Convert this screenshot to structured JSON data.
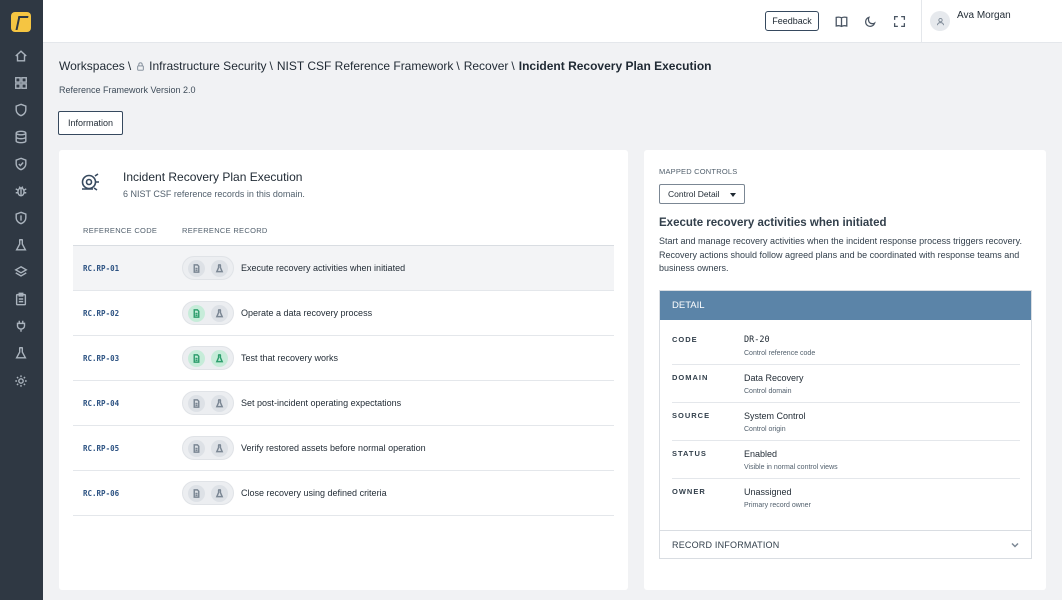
{
  "header": {
    "feedback_label": "Feedback",
    "user_name": "Ava Morgan"
  },
  "sidebar": {
    "items": [
      "home-icon",
      "grid-icon",
      "shield-icon",
      "database-icon",
      "shield-check-icon",
      "bug-icon",
      "shield-icon",
      "flask-icon",
      "layers-icon",
      "clipboard-icon",
      "plug-icon",
      "flask-icon",
      "gear-icon"
    ]
  },
  "breadcrumb": {
    "items": [
      "Workspaces",
      "Infrastructure Security",
      "NIST CSF Reference Framework",
      "Recover"
    ],
    "separator": "\\",
    "current": "Incident Recovery Plan Execution"
  },
  "page": {
    "subtitle": "Reference Framework Version 2.0",
    "info_button": "Information"
  },
  "left_panel": {
    "title": "Incident Recovery Plan Execution",
    "subtitle": "6 NIST CSF reference records in this domain.",
    "columns": [
      "REFERENCE CODE",
      "REFERENCE RECORD"
    ],
    "rows": [
      {
        "code": "RC.RP-01",
        "label": "Execute recovery activities when initiated",
        "doc_status": "gray",
        "test_status": "gray",
        "selected": true
      },
      {
        "code": "RC.RP-02",
        "label": "Operate a data recovery process",
        "doc_status": "green",
        "test_status": "gray",
        "selected": false
      },
      {
        "code": "RC.RP-03",
        "label": "Test that recovery works",
        "doc_status": "green",
        "test_status": "green",
        "selected": false
      },
      {
        "code": "RC.RP-04",
        "label": "Set post-incident operating expectations",
        "doc_status": "gray",
        "test_status": "gray",
        "selected": false
      },
      {
        "code": "RC.RP-05",
        "label": "Verify restored assets before normal operation",
        "doc_status": "gray",
        "test_status": "gray",
        "selected": false
      },
      {
        "code": "RC.RP-06",
        "label": "Close recovery using defined criteria",
        "doc_status": "gray",
        "test_status": "gray",
        "selected": false
      }
    ]
  },
  "right_panel": {
    "mapped_label": "MAPPED CONTROLS",
    "select_value": "Control Detail",
    "control_title": "Execute recovery activities when initiated",
    "control_desc": "Start and manage recovery activities when the incident response process triggers recovery. Recovery actions should follow agreed plans and be coordinated with response teams and business owners.",
    "detail_title": "DETAIL",
    "details": [
      {
        "key": "CODE",
        "value": "DR-20",
        "note": "Control reference code",
        "mono": true
      },
      {
        "key": "DOMAIN",
        "value": "Data Recovery",
        "note": "Control domain",
        "mono": false
      },
      {
        "key": "SOURCE",
        "value": "System Control",
        "note": "Control origin",
        "mono": false
      },
      {
        "key": "STATUS",
        "value": "Enabled",
        "note": "Visible in normal control views",
        "mono": false
      },
      {
        "key": "OWNER",
        "value": "Unassigned",
        "note": "Primary record owner",
        "mono": false
      }
    ],
    "record_info_label": "RECORD INFORMATION"
  },
  "colors": {
    "sidebar_bg": "#2f3843",
    "logo": "#f5c542",
    "code_link": "#2c5282",
    "detail_header": "#5b84a8",
    "status_green": "#2f9e6e"
  }
}
